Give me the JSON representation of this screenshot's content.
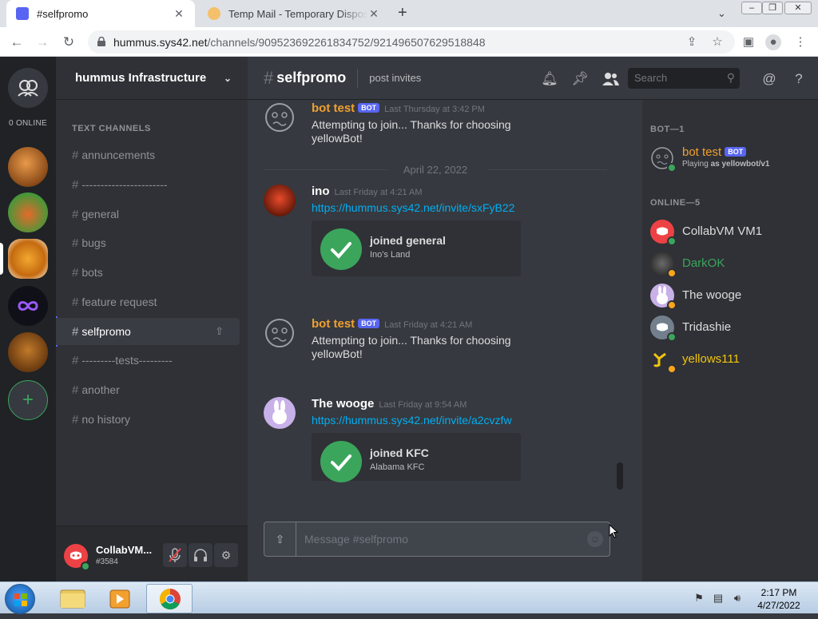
{
  "browser": {
    "tabs": [
      {
        "title": "#selfpromo",
        "active": true
      },
      {
        "title": "Temp Mail - Temporary Disposable Email",
        "active": false
      }
    ],
    "new_tab_symbol": "+",
    "close_symbol": "✕",
    "url_host": "hummus.sys42.net",
    "url_path": "/channels/909523692261834752/921496507629518848"
  },
  "guilds": {
    "online_count": "0 ONLINE",
    "add_symbol": "+"
  },
  "server": {
    "name": "hummus Infrastructure",
    "category": "TEXT CHANNELS",
    "channels": [
      {
        "name": "annuncements"
      },
      {
        "name": "-----------------------"
      },
      {
        "name": "general"
      },
      {
        "name": "bugs"
      },
      {
        "name": "bots"
      },
      {
        "name": "feature request"
      },
      {
        "name": "selfpromo",
        "active": true
      },
      {
        "name": "---------tests---------"
      },
      {
        "name": "another"
      },
      {
        "name": "no history"
      }
    ]
  },
  "user_panel": {
    "name": "CollabVM...",
    "tag": "#3584"
  },
  "channel_header": {
    "name": "selfpromo",
    "topic": "post invites",
    "search_placeholder": "Search"
  },
  "messages": [
    {
      "author": "bot test",
      "bot": true,
      "bot_label": "BOT",
      "time": "Last Thursday at 3:42 PM",
      "text": "Attempting to join... Thanks for choosing yellowBot!",
      "author_color": "#f0a030"
    },
    {
      "date_separator": "April 22, 2022"
    },
    {
      "author": "ino",
      "bot": false,
      "time": "Last Friday at 4:21 AM",
      "link": "https://hummus.sys42.net/invite/sxFyB22",
      "embed": {
        "title": "joined general",
        "subtitle": "Ino's Land"
      },
      "author_color": "#ffffff"
    },
    {
      "author": "bot test",
      "bot": true,
      "bot_label": "BOT",
      "time": "Last Friday at 4:21 AM",
      "text": "Attempting to join... Thanks for choosing yellowBot!",
      "author_color": "#f0a030"
    },
    {
      "author": "The wooge",
      "bot": false,
      "time": "Last Friday at 9:54 AM",
      "link": "https://hummus.sys42.net/invite/a2cvzfw",
      "embed": {
        "title": "joined KFC",
        "subtitle": "Alabama KFC"
      },
      "author_color": "#ffffff"
    }
  ],
  "composer": {
    "placeholder": "Message #selfpromo"
  },
  "member_list": {
    "bot_category": "BOT—1",
    "online_category": "ONLINE—5",
    "bot_member": {
      "name": "bot test",
      "badge": "BOT",
      "activity_prefix": "Playing ",
      "activity_game": "as yellowbot/v1",
      "name_color": "#f0a030"
    },
    "online_members": [
      {
        "name": "CollabVM VM1",
        "name_color": "#dcddde",
        "status": "online"
      },
      {
        "name": "DarkOK",
        "name_color": "#3ba55c",
        "status": "idle"
      },
      {
        "name": "The wooge",
        "name_color": "#dcddde",
        "status": "idle"
      },
      {
        "name": "Tridashie",
        "name_color": "#dcddde",
        "status": "online"
      },
      {
        "name": "yellows111",
        "name_color": "#f1c40f",
        "status": "idle"
      }
    ]
  },
  "taskbar": {
    "time": "2:17 PM",
    "date": "4/27/2022"
  }
}
